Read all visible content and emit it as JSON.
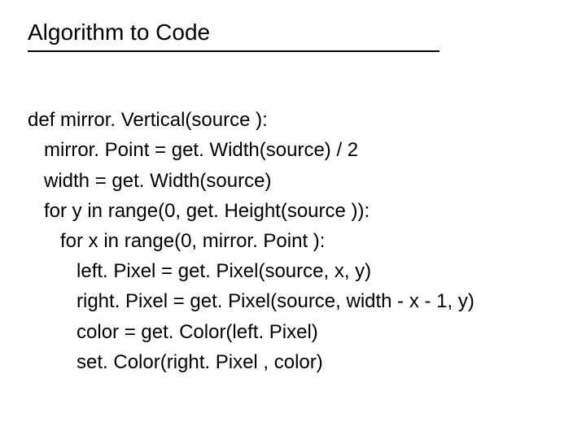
{
  "title": "Algorithm to Code",
  "code": {
    "l1": "def mirror. Vertical(source ):",
    "l2": "   mirror. Point = get. Width(source) / 2",
    "l3": "   width = get. Width(source)",
    "l4": "   for y in range(0, get. Height(source )):",
    "l5": "      for x in range(0, mirror. Point ):",
    "l6": "         left. Pixel = get. Pixel(source, x, y)",
    "l7": "         right. Pixel = get. Pixel(source, width - x - 1, y)",
    "l8": "         color = get. Color(left. Pixel)",
    "l9": "         set. Color(right. Pixel , color)"
  }
}
